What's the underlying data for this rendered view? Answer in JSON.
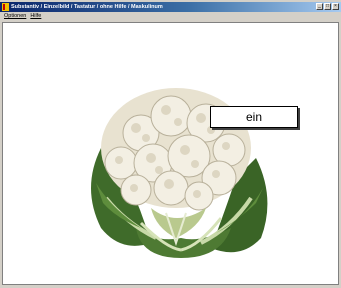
{
  "window": {
    "title": "Substantiv / Einzelbild / Tastatur / ohne Hilfe / Maskulinum",
    "minimize_glyph": "_",
    "maximize_glyph": "□",
    "close_glyph": "×"
  },
  "menu": {
    "items": [
      {
        "label": "Optionen"
      },
      {
        "label": "Hilfe"
      }
    ]
  },
  "main": {
    "image_icon": "cauliflower-image",
    "answer_button_label": "ein"
  },
  "colors": {
    "titlebar_start": "#0a246a",
    "titlebar_end": "#a6caf0",
    "content_background": "#ffffff"
  }
}
